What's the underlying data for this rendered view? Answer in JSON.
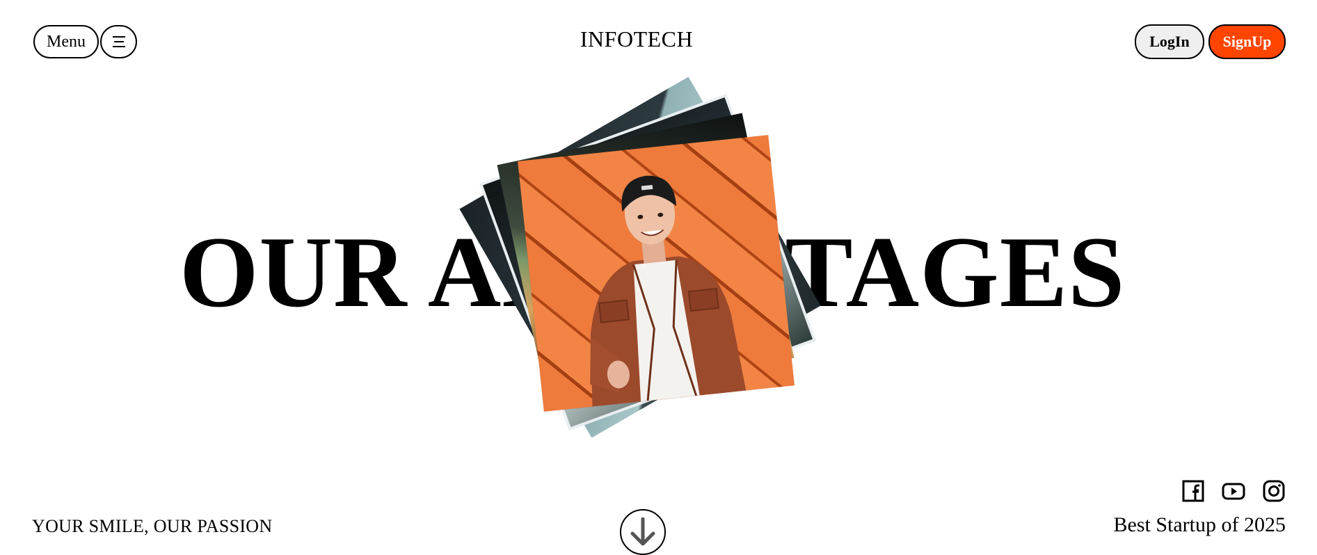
{
  "header": {
    "menu_label": "Menu",
    "brand": "INFOTECH",
    "login_label": "LogIn",
    "signup_label": "SignUp"
  },
  "hero": {
    "headline": "OUR ADVANTAGES"
  },
  "footer": {
    "tagline": "YOUR SMILE, OUR PASSION",
    "award": "Best Startup of 2025",
    "social_icons": [
      "facebook-icon",
      "youtube-icon",
      "instagram-icon"
    ],
    "scroll_icon": "arrow-down-icon"
  },
  "colors": {
    "accent": "#ff4500",
    "login_bg": "#efefef",
    "photo_wall": "#ee7a3c"
  }
}
